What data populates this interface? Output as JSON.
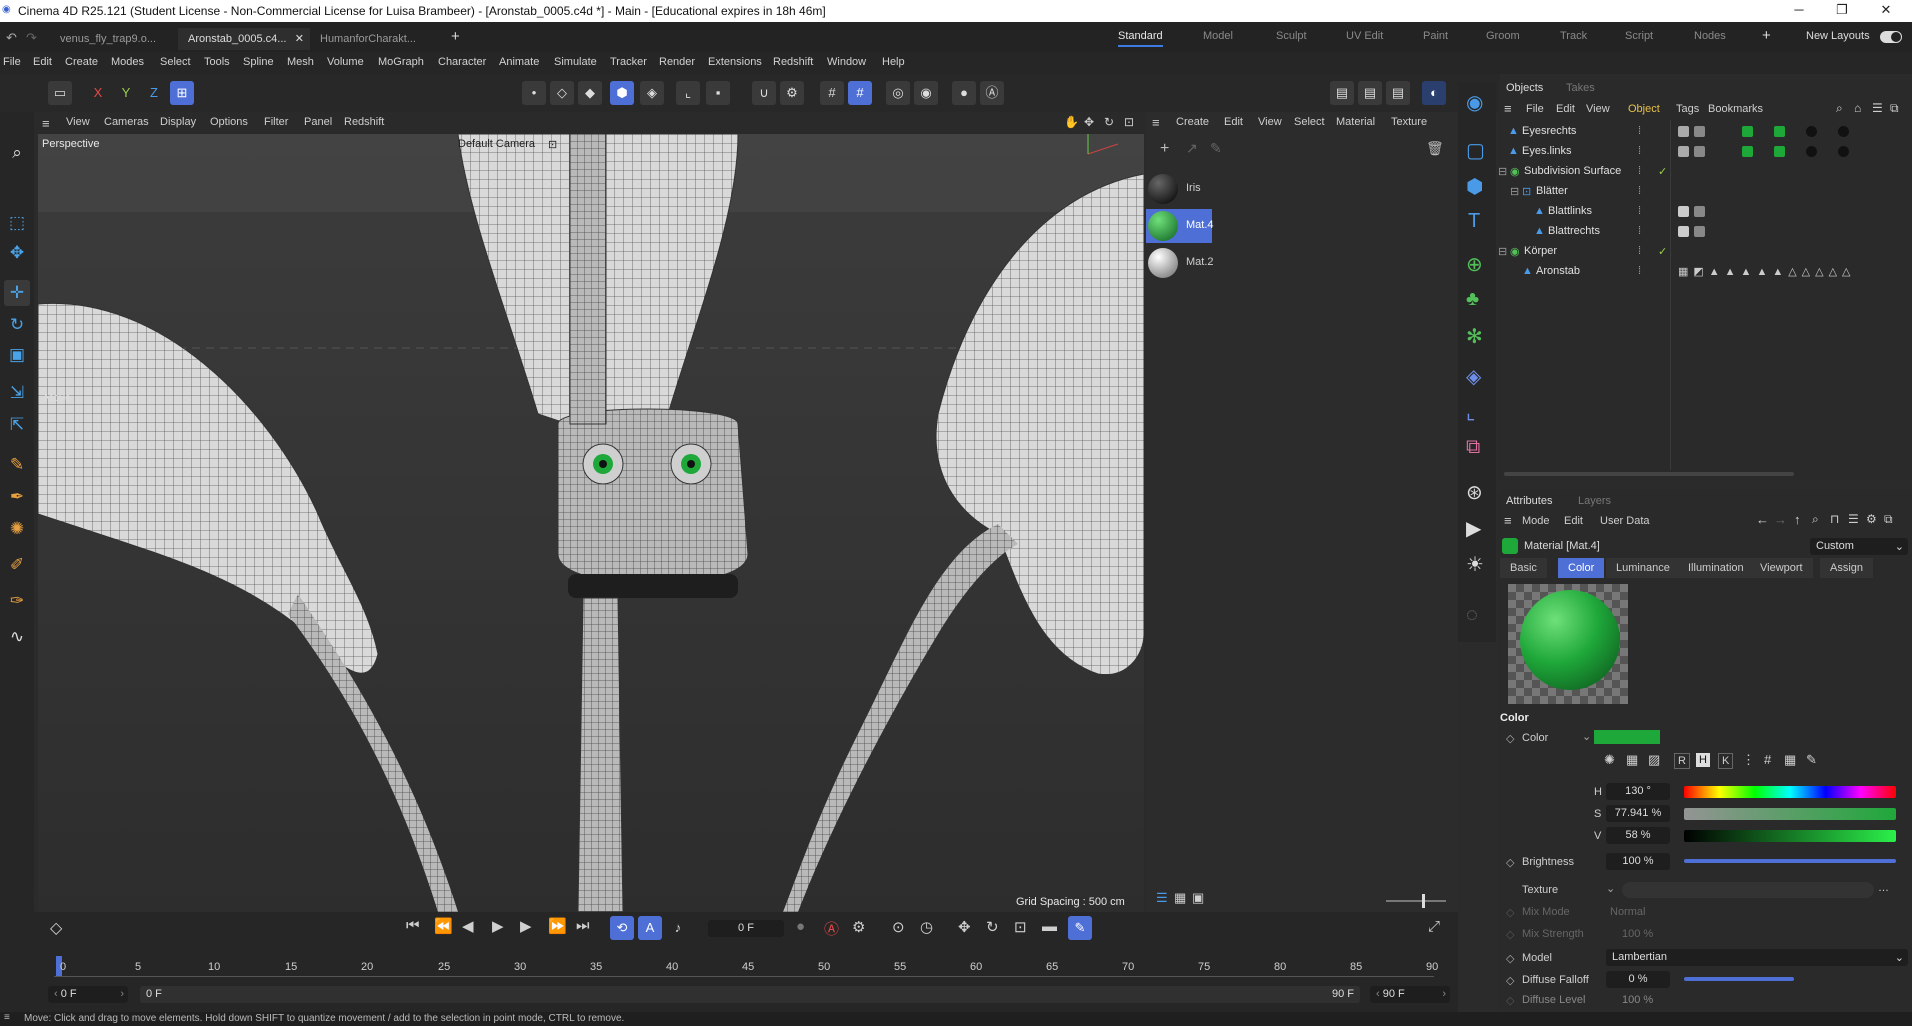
{
  "titlebar": {
    "title": "Cinema 4D R25.121 (Student License - Non-Commercial License for Luisa Brambeer) - [Aronstab_0005.c4d *] - Main - [Educational expires in 18h 46m]",
    "minimize": "─",
    "maximize": "❐",
    "close": "✕"
  },
  "doc_tabs": [
    "venus_fly_trap9.o...",
    "Aronstab_0005.c4...",
    "HumanforCharakt..."
  ],
  "new_tab": "+",
  "layouts": [
    "Standard",
    "Model",
    "Sculpt",
    "UV Edit",
    "Paint",
    "Groom",
    "Track",
    "Script",
    "Nodes"
  ],
  "layout_add": "+",
  "new_layouts": "New Layouts",
  "menu": [
    "File",
    "Edit",
    "Create",
    "Modes",
    "Select",
    "Tools",
    "Spline",
    "Mesh",
    "Volume",
    "MoGraph",
    "Character",
    "Animate",
    "Simulate",
    "Tracker",
    "Render",
    "Extensions",
    "Redshift",
    "Window",
    "Help"
  ],
  "axes": {
    "x": "X",
    "y": "Y",
    "z": "Z"
  },
  "viewport": {
    "menu": [
      "View",
      "Cameras",
      "Display",
      "Options",
      "Filter",
      "Panel",
      "Redshift"
    ],
    "label": "Perspective",
    "camera": "Default Camera",
    "camera_icon": "⊡",
    "tool_hint": "Move",
    "grid": "Grid Spacing : 500 cm"
  },
  "material_panel": {
    "menu": [
      "Create",
      "Edit",
      "View",
      "Select",
      "Material",
      "Texture"
    ],
    "materials": [
      {
        "name": "Iris",
        "color": "#111111"
      },
      {
        "name": "Mat.4",
        "color": "#1fa83a"
      },
      {
        "name": "Mat.2",
        "color": "#cfcfcf"
      }
    ]
  },
  "objects_panel": {
    "tabs": [
      "Objects",
      "Takes"
    ],
    "menu": [
      "File",
      "Edit",
      "View",
      "Object",
      "Tags",
      "Bookmarks"
    ],
    "items": [
      {
        "name": "Eyesrechts",
        "indent": 1
      },
      {
        "name": "Eyes.links",
        "indent": 1
      },
      {
        "name": "Subdivision Surface",
        "indent": 0
      },
      {
        "name": "Blätter",
        "indent": 1
      },
      {
        "name": "Blattlinks",
        "indent": 2
      },
      {
        "name": "Blattrechts",
        "indent": 2
      },
      {
        "name": "Körper",
        "indent": 0
      },
      {
        "name": "Aronstab",
        "indent": 1
      }
    ]
  },
  "attributes_panel": {
    "tabs": [
      "Attributes",
      "Layers"
    ],
    "menu": [
      "Mode",
      "Edit",
      "User Data"
    ],
    "title": "Material [Mat.4]",
    "preset": "Custom",
    "subtabs": [
      "Basic",
      "Color",
      "Luminance",
      "Illumination",
      "Viewport",
      "Assign"
    ],
    "section": "Color",
    "color_label": "Color",
    "color_hex": "#1fa83a",
    "mode_buttons": [
      "R",
      "H",
      "K"
    ],
    "h_label": "H",
    "h_value": "130 °",
    "s_label": "S",
    "s_value": "77.941 %",
    "v_label": "V",
    "v_value": "58 %",
    "brightness_label": "Brightness",
    "brightness_value": "100 %",
    "texture_label": "Texture",
    "mix_mode_label": "Mix Mode",
    "mix_mode_value": "Normal",
    "mix_strength_label": "Mix Strength",
    "mix_strength_value": "100 %",
    "model_label": "Model",
    "model_value": "Lambertian",
    "diffuse_falloff_label": "Diffuse Falloff",
    "diffuse_falloff_value": "0 %",
    "diffuse_level_label": "Diffuse Level",
    "diffuse_level_value": "100 %"
  },
  "timeline": {
    "frame_field": "0 F",
    "ticks": [
      "0",
      "5",
      "10",
      "15",
      "20",
      "25",
      "30",
      "35",
      "40",
      "45",
      "50",
      "55",
      "60",
      "65",
      "70",
      "75",
      "80",
      "85",
      "90"
    ],
    "start_field": "0 F",
    "start_field2": "0 F",
    "end_field": "90 F",
    "end_field2": "90 F"
  },
  "status": "Move: Click and drag to move elements. Hold down SHIFT to quantize movement / add to the selection in point mode, CTRL to remove."
}
